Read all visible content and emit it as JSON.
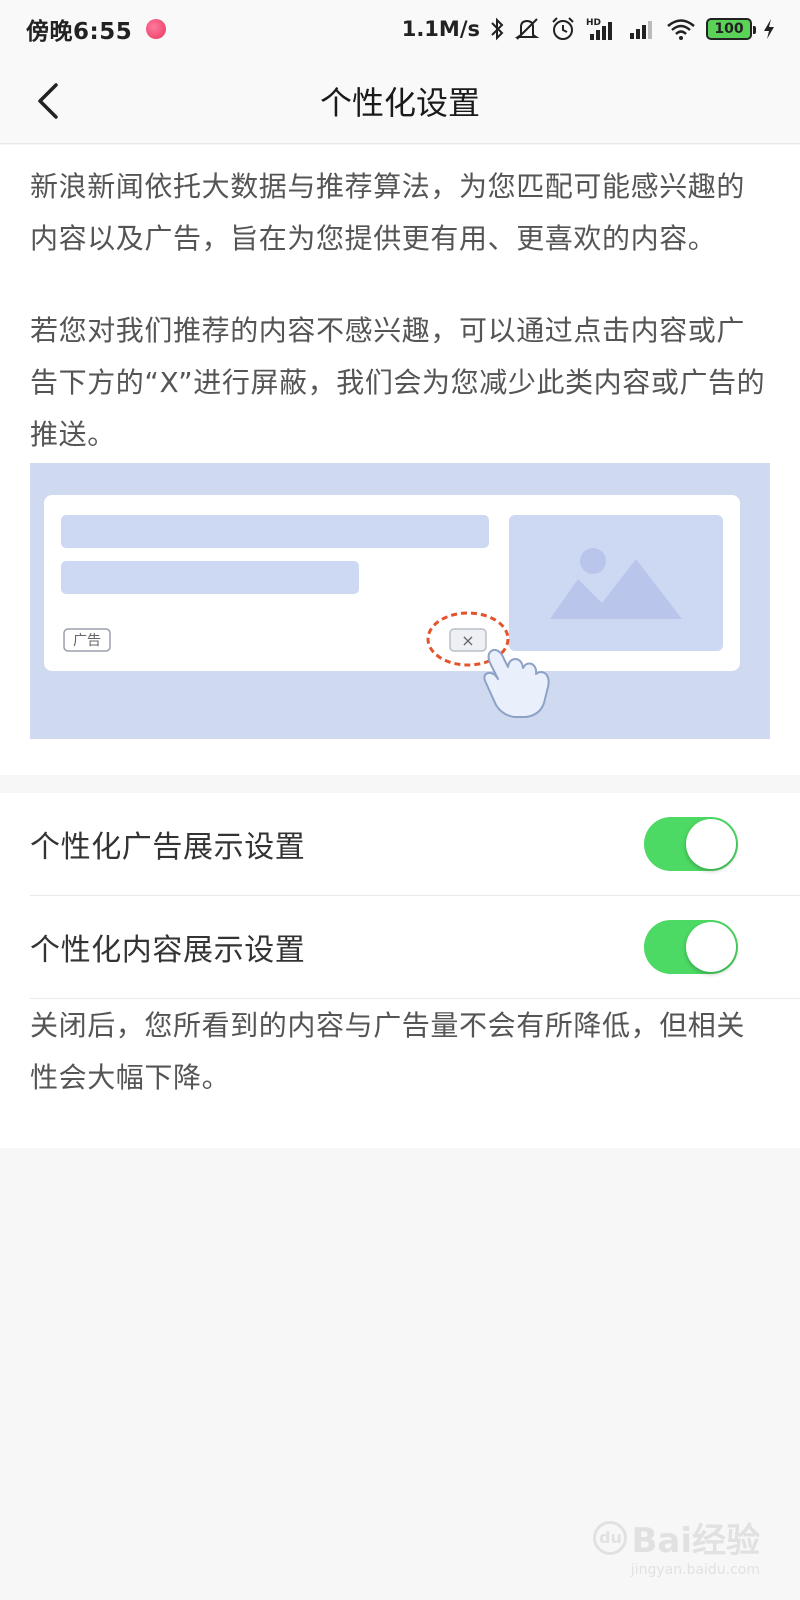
{
  "status_bar": {
    "time": "傍晚6:55",
    "network_speed": "1.1M/s",
    "battery_level": "100",
    "icons": [
      "bluetooth-icon",
      "mute-icon",
      "alarm-icon",
      "hd-signal-icon",
      "signal-icon",
      "wifi-icon",
      "battery-icon",
      "charging-icon"
    ]
  },
  "nav": {
    "back_icon": "chevron-left-icon",
    "title": "个性化设置"
  },
  "intro": {
    "paragraph_1": "新浪新闻依托大数据与推荐算法，为您匹配可能感兴趣的内容以及广告，旨在为您提供更有用、更喜欢的内容。",
    "paragraph_2": "若您对我们推荐的内容不感兴趣，可以通过点击内容或广告下方的“X”进行屏蔽，我们会为您减少此类内容或广告的推送。"
  },
  "illustration": {
    "ad_tag": "广告",
    "close_glyph": "×",
    "colors": {
      "background": "#cfd9ef",
      "card": "#ffffff",
      "placeholder": "#cdd8f3",
      "dashed_ring": "#e2542b"
    }
  },
  "settings": {
    "items": [
      {
        "label": "个性化广告展示设置",
        "enabled": true
      },
      {
        "label": "个性化内容展示设置",
        "enabled": true
      }
    ],
    "note": "关闭后，您所看到的内容与广告量不会有所降低，但相关性会大幅下降。",
    "toggle_color": "#4cd964"
  },
  "watermark": {
    "logo_text": "Bai经验",
    "paw_glyph": "du",
    "url": "jingyan.baidu.com"
  }
}
